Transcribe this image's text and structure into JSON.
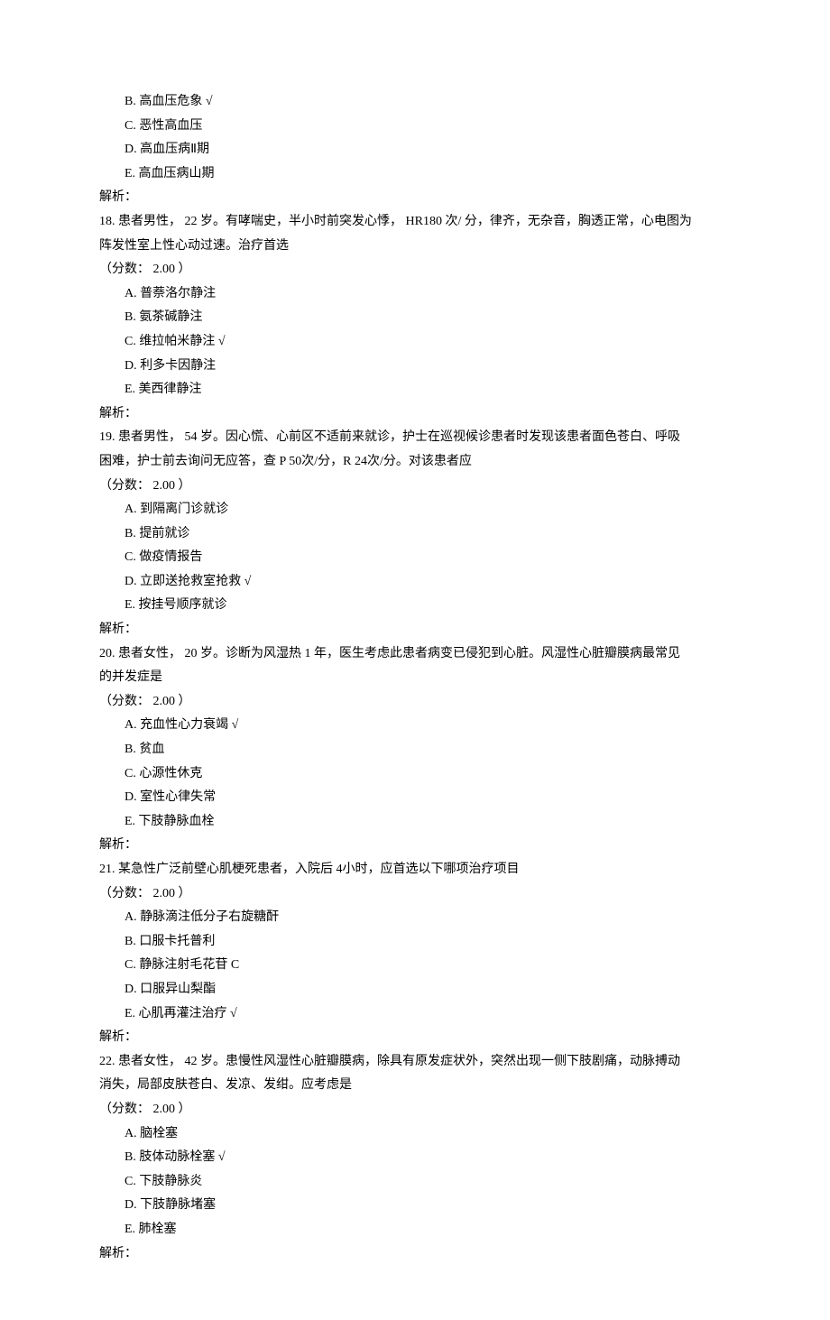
{
  "partial": {
    "options": [
      "B.  高血压危象  √",
      "C.  恶性高血压",
      "D.  高血压病Ⅱ期",
      "E.  高血压病山期"
    ],
    "analysis": "解析："
  },
  "questions": [
    {
      "num": "18.",
      "text_lines": [
        "患者男性，  22 岁。有哮喘史，半小时前突发心悸，   HR180 次/ 分，律齐，无杂音，胸透正常，心电图为",
        "阵发性室上性心动过速。治疗首选"
      ],
      "score": "（分数：  2.00 ）",
      "options": [
        "A.  普萘洛尔静注",
        "B.  氨茶碱静注",
        "C.  维拉帕米静注  √",
        "D.  利多卡因静注",
        "E.  美西律静注"
      ],
      "analysis": "解析："
    },
    {
      "num": "19.",
      "text_lines": [
        "患者男性，  54 岁。因心慌、心前区不适前来就诊，护士在巡视候诊患者时发现该患者面色苍白、呼吸",
        "困难，护士前去询问无应答，查   P 50次/分，R 24次/分。对该患者应"
      ],
      "score": "（分数：  2.00 ）",
      "options": [
        "A.  到隔离门诊就诊",
        "B.  提前就诊",
        "C.  做疫情报告",
        "D.  立即送抢救室抢救  √",
        "E.  按挂号顺序就诊"
      ],
      "analysis": "解析："
    },
    {
      "num": "20.",
      "text_lines": [
        "患者女性，  20 岁。诊断为风湿热  1 年，医生考虑此患者病变已侵犯到心脏。风湿性心脏瓣膜病最常见",
        "的并发症是"
      ],
      "score": "（分数：  2.00 ）",
      "options": [
        "A.  充血性心力衰竭  √",
        "B.  贫血",
        "C.  心源性休克",
        "D.  室性心律失常",
        "E.  下肢静脉血栓"
      ],
      "analysis": "解析："
    },
    {
      "num": "21.",
      "text_lines": [
        "某急性广泛前壁心肌梗死患者，入院后  4小时，应首选以下哪项治疗项目"
      ],
      "score": "（分数：  2.00 ）",
      "options": [
        "A.  静脉滴注低分子右旋糖酐",
        "B.  口服卡托普利",
        "C.  静脉注射毛花苷  C",
        "D.  口服异山梨酯",
        "E.  心肌再灌注治疗  √"
      ],
      "analysis": "解析："
    },
    {
      "num": "22.",
      "text_lines": [
        "患者女性，  42 岁。患慢性风湿性心脏瓣膜病，除具有原发症状外，突然出现一侧下肢剧痛，动脉搏动",
        "消失，局部皮肤苍白、发凉、发绀。应考虑是"
      ],
      "score": "（分数：  2.00 ）",
      "options": [
        "A.  脑栓塞",
        "B.  肢体动脉栓塞  √",
        "C.  下肢静脉炎",
        "D.  下肢静脉堵塞",
        "E.  肺栓塞"
      ],
      "analysis": "解析："
    }
  ]
}
